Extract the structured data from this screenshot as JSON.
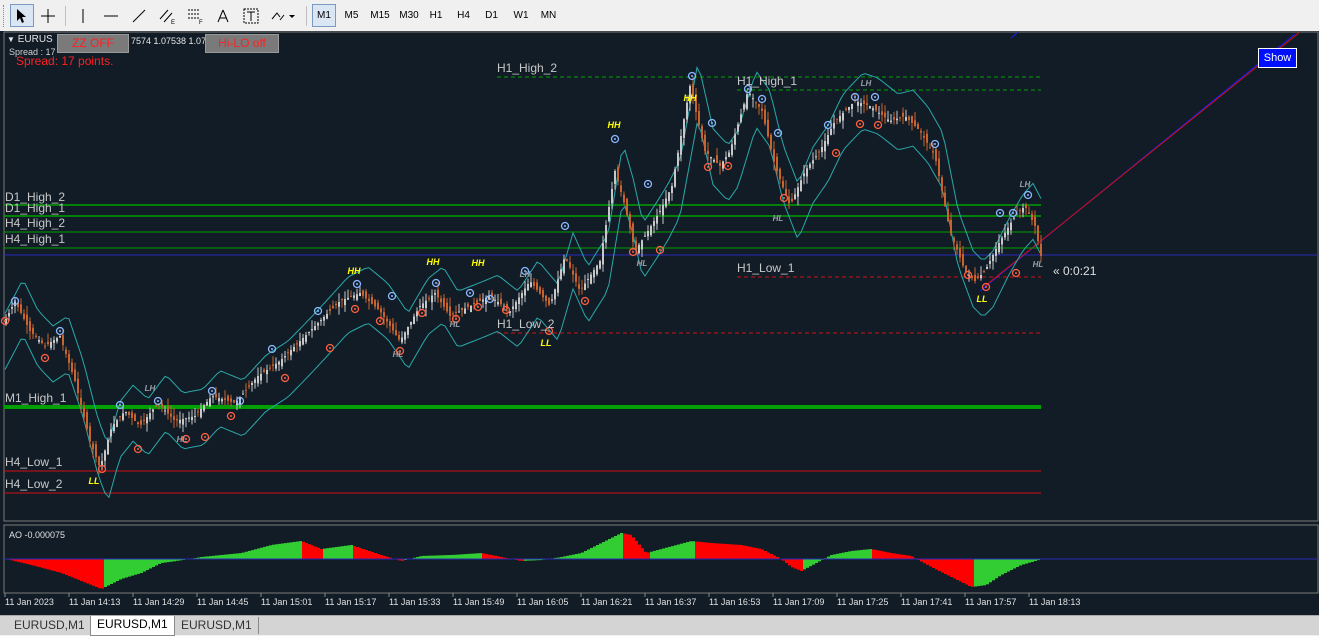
{
  "toolbar": {
    "tools": [
      "cursor-icon",
      "crosshair-icon",
      "vertical-line-icon",
      "horizontal-line-icon",
      "trendline-icon",
      "equidistant-channel-icon",
      "fibonacci-icon",
      "text-icon",
      "text-label-icon",
      "arrows-icon"
    ],
    "timeframes": [
      "M1",
      "M5",
      "M15",
      "M30",
      "H1",
      "H4",
      "D1",
      "W1",
      "MN"
    ],
    "active_timeframe": "M1"
  },
  "chart": {
    "symbol_header": "EURUS",
    "price_fragment": "7574 1.07538 1.07",
    "spread_label": "Spread : 17",
    "spread_text": "Spread: 17 points.",
    "zz_button": "ZZ OFF",
    "hilo_button": "Hi-LO off",
    "show_button": "Show",
    "countdown": "« 0:0:21",
    "level_labels": {
      "d1_high_2": "D1_High_2",
      "d1_high_1": "D1_High_1",
      "h4_high_2": "H4_High_2",
      "h4_high_1": "H4_High_1",
      "m1_high_1": "M1_High_1",
      "h4_low_1": "H4_Low_1",
      "h4_low_2": "H4_Low_2",
      "h1_high_2": "H1_High_2",
      "h1_high_1": "H1_High_1",
      "h1_low_1": "H1_Low_1",
      "h1_low_2": "H1_Low_2"
    },
    "indicator_label": "AO -0.000075",
    "time_labels": [
      "11 Jan 2023",
      "11 Jan 14:13",
      "11 Jan 14:29",
      "11 Jan 14:45",
      "11 Jan 15:01",
      "11 Jan 15:17",
      "11 Jan 15:33",
      "11 Jan 15:49",
      "11 Jan 16:05",
      "11 Jan 16:21",
      "11 Jan 16:37",
      "11 Jan 16:53",
      "11 Jan 17:09",
      "11 Jan 17:25",
      "11 Jan 17:41",
      "11 Jan 17:57",
      "11 Jan 18:13"
    ],
    "swing_labels": [
      "LL",
      "LH",
      "HL",
      "HH",
      "HL",
      "HH",
      "HH",
      "HL",
      "LH",
      "LL",
      "HH",
      "HL",
      "HH",
      "HL",
      "LH",
      "LL",
      "LH",
      "HL"
    ],
    "colors": {
      "background": "#121c27",
      "bull_candle": "#c8c8c8",
      "bear_candle": "#c8642e",
      "envelope": "#2aa8a8",
      "green_level": "#00a000",
      "red_level": "#d01010",
      "ao_up": "#32cd32",
      "ao_down": "#ff0000",
      "hh_ll_label": "#ffff00",
      "hl_lh_label": "#9aa0a8"
    }
  },
  "tabs": [
    {
      "label": "EURUSD,M1"
    },
    {
      "label": "EURUSD,M1"
    },
    {
      "label": "EURUSD,M1"
    }
  ],
  "active_tab": 1
}
